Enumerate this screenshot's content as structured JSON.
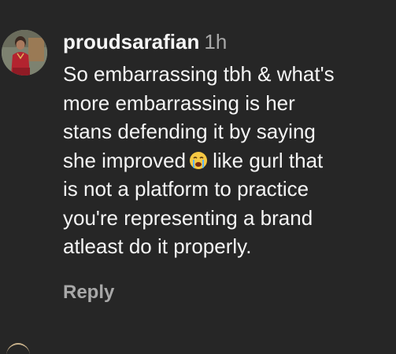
{
  "comment": {
    "username": "proudsarafian",
    "timestamp": "1h",
    "text_lines": [
      "So embarrassing tbh & what's",
      "more embarrassing is her",
      "stans defending it by saying",
      "she improved",
      "like gurl that",
      "is not a platform to practice",
      "you're representing a brand",
      "atleast do it properly."
    ],
    "emoji": "loudly-crying-face",
    "reply_label": "Reply"
  },
  "colors": {
    "background": "#262626",
    "primary_text": "#f5f5f5",
    "secondary_text": "#a8a8a8"
  }
}
